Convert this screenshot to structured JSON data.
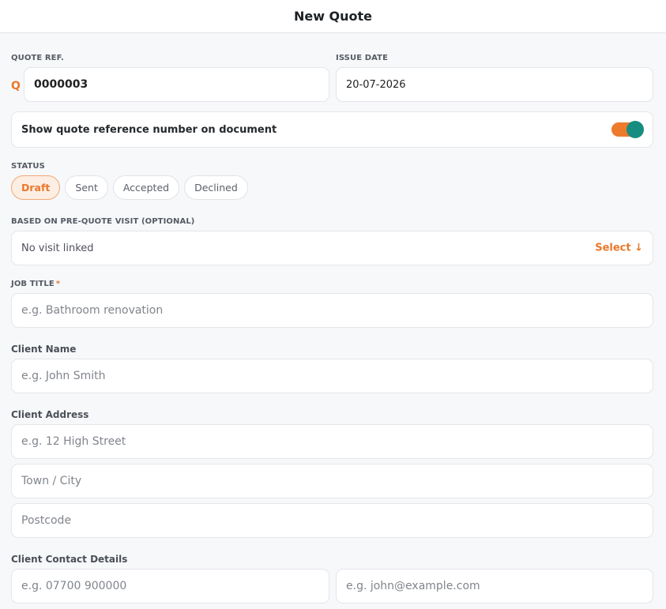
{
  "header": {
    "title": "New Quote"
  },
  "quote_ref": {
    "label": "QUOTE REF.",
    "prefix": "Q",
    "value": "0000003"
  },
  "issue_date": {
    "label": "ISSUE DATE",
    "value": "20-07-2026"
  },
  "show_ref_toggle": {
    "label": "Show quote reference number on document",
    "on": true
  },
  "status": {
    "label": "STATUS",
    "options": [
      "Draft",
      "Sent",
      "Accepted",
      "Declined"
    ],
    "selected": "Draft"
  },
  "pre_quote_visit": {
    "label": "BASED ON PRE-QUOTE VISIT (OPTIONAL)",
    "value": "No visit linked",
    "action": "Select ↓"
  },
  "job_title": {
    "label": "JOB TITLE",
    "required_mark": "*",
    "placeholder": "e.g. Bathroom renovation"
  },
  "client_name": {
    "label": "Client Name",
    "placeholder": "e.g. John Smith"
  },
  "client_address": {
    "label": "Client Address",
    "line1_placeholder": "e.g. 12 High Street",
    "town_placeholder": "Town / City",
    "postcode_placeholder": "Postcode"
  },
  "client_contact": {
    "label": "Client Contact Details",
    "phone_placeholder": "e.g. 07700 900000",
    "email_placeholder": "e.g. john@example.com"
  },
  "colors": {
    "accent": "#e8782a",
    "toggle_knob": "#168d80",
    "background": "#f7f8fa"
  }
}
